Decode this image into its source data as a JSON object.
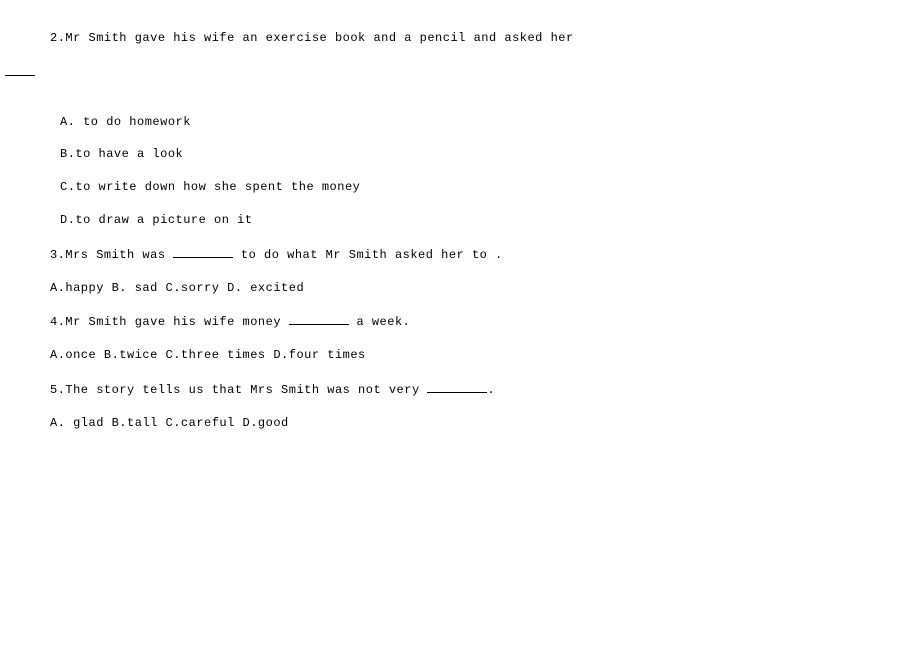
{
  "q2": {
    "stem": "2.Mr Smith gave his wife an exercise book and a pencil and asked her",
    "options": {
      "a": "A.  to do homework",
      "b": "B.to have a look",
      "c": "C.to write down how she spent the money",
      "d": "D.to draw a picture on it"
    }
  },
  "q3": {
    "stem_prefix": "3.Mrs Smith was ",
    "stem_suffix": " to do what Mr Smith asked her to .",
    "options": "A.happy B. sad C.sorry D. excited"
  },
  "q4": {
    "stem_prefix": "4.Mr Smith gave his wife money ",
    "stem_suffix": " a week.",
    "options": "A.once B.twice C.three times D.four times"
  },
  "q5": {
    "stem_prefix": "5.The story tells us that Mrs Smith was not very ",
    "stem_suffix": ".",
    "options": " A. glad  B.tall  C.careful  D.good"
  }
}
